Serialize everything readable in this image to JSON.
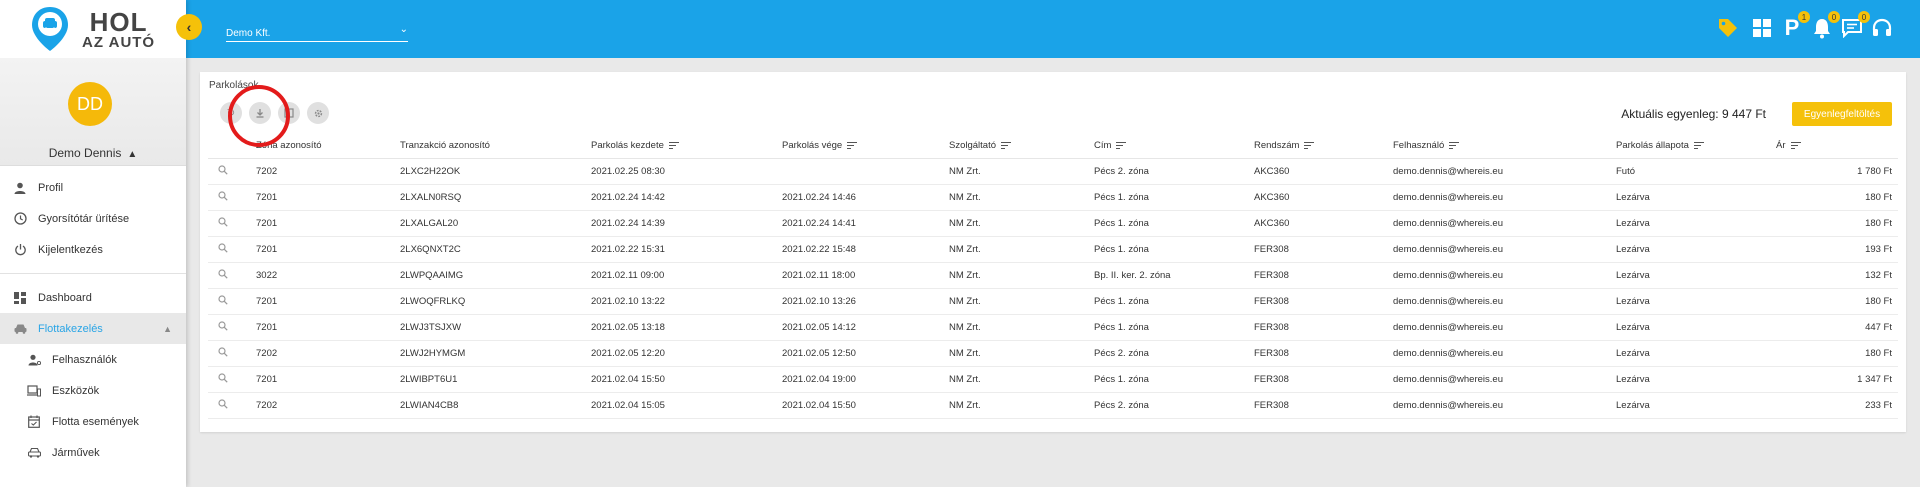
{
  "logo": {
    "line1": "HOL",
    "line2": "AZ AUTÓ"
  },
  "profile": {
    "initials": "DD",
    "name": "Demo Dennis"
  },
  "nav": {
    "profile": "Profil",
    "cache": "Gyorsítótár ürítése",
    "logout": "Kijelentkezés",
    "dashboard": "Dashboard",
    "fleet": "Flottakezelés",
    "users": "Felhasználók",
    "devices": "Eszközök",
    "events": "Flotta események",
    "vehicles": "Járművek"
  },
  "header": {
    "company": "Demo Kft.",
    "badges": {
      "parking": "1",
      "notifications": "0",
      "messages": "0"
    },
    "accent_color": "#1aa3e8",
    "yellow": "#f5c10a"
  },
  "panel": {
    "title": "Parkolások",
    "balance_text": "Aktuális egyenleg: 9 447 Ft",
    "topup_label": "Egyenlegfeltöltés"
  },
  "table": {
    "headers": [
      "Zóna azonosító",
      "Tranzakció azonosító",
      "Parkolás kezdete",
      "Parkolás vége",
      "Szolgáltató",
      "Cím",
      "Rendszám",
      "Felhasználó",
      "Parkolás állapota",
      "Ár"
    ],
    "rows": [
      [
        "7202",
        "2LXC2H22OK",
        "2021.02.25 08:30",
        "",
        "NM Zrt.",
        "Pécs 2. zóna",
        "AKC360",
        "demo.dennis@whereis.eu",
        "Futó",
        "1 780 Ft"
      ],
      [
        "7201",
        "2LXALN0RSQ",
        "2021.02.24 14:42",
        "2021.02.24 14:46",
        "NM Zrt.",
        "Pécs 1. zóna",
        "AKC360",
        "demo.dennis@whereis.eu",
        "Lezárva",
        "180 Ft"
      ],
      [
        "7201",
        "2LXALGAL20",
        "2021.02.24 14:39",
        "2021.02.24 14:41",
        "NM Zrt.",
        "Pécs 1. zóna",
        "AKC360",
        "demo.dennis@whereis.eu",
        "Lezárva",
        "180 Ft"
      ],
      [
        "7201",
        "2LX6QNXT2C",
        "2021.02.22 15:31",
        "2021.02.22 15:48",
        "NM Zrt.",
        "Pécs 1. zóna",
        "FER308",
        "demo.dennis@whereis.eu",
        "Lezárva",
        "193 Ft"
      ],
      [
        "3022",
        "2LWPQAAIMG",
        "2021.02.11 09:00",
        "2021.02.11 18:00",
        "NM Zrt.",
        "Bp. II. ker. 2. zóna",
        "FER308",
        "demo.dennis@whereis.eu",
        "Lezárva",
        "132 Ft"
      ],
      [
        "7201",
        "2LWOQFRLKQ",
        "2021.02.10 13:22",
        "2021.02.10 13:26",
        "NM Zrt.",
        "Pécs 1. zóna",
        "FER308",
        "demo.dennis@whereis.eu",
        "Lezárva",
        "180 Ft"
      ],
      [
        "7201",
        "2LWJ3TSJXW",
        "2021.02.05 13:18",
        "2021.02.05 14:12",
        "NM Zrt.",
        "Pécs 1. zóna",
        "FER308",
        "demo.dennis@whereis.eu",
        "Lezárva",
        "447 Ft"
      ],
      [
        "7202",
        "2LWJ2HYMGM",
        "2021.02.05 12:20",
        "2021.02.05 12:50",
        "NM Zrt.",
        "Pécs 2. zóna",
        "FER308",
        "demo.dennis@whereis.eu",
        "Lezárva",
        "180 Ft"
      ],
      [
        "7201",
        "2LWIBPT6U1",
        "2021.02.04 15:50",
        "2021.02.04 19:00",
        "NM Zrt.",
        "Pécs 1. zóna",
        "FER308",
        "demo.dennis@whereis.eu",
        "Lezárva",
        "1 347 Ft"
      ],
      [
        "7202",
        "2LWIAN4CB8",
        "2021.02.04 15:05",
        "2021.02.04 15:50",
        "NM Zrt.",
        "Pécs 2. zóna",
        "FER308",
        "demo.dennis@whereis.eu",
        "Lezárva",
        "233 Ft"
      ]
    ]
  }
}
